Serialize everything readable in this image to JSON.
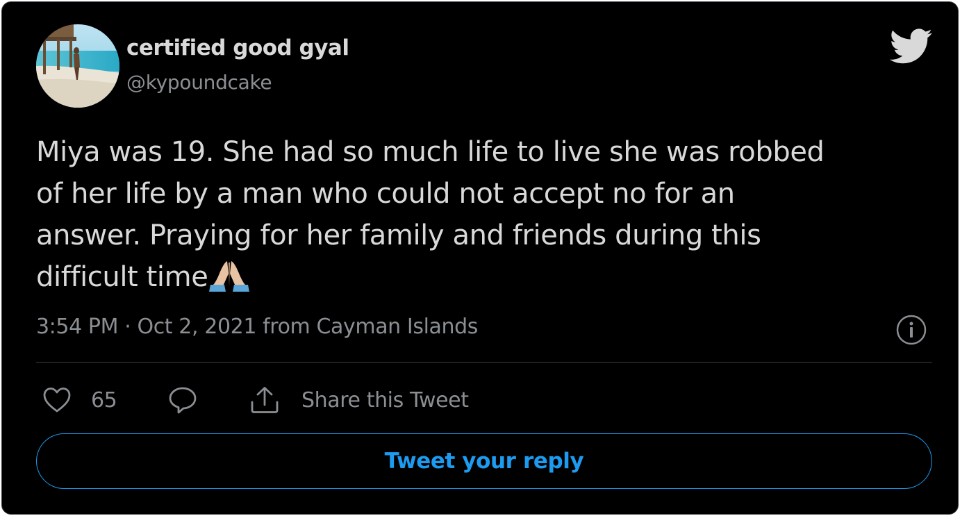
{
  "author": {
    "display_name": "certified good gyal",
    "handle": "@kypoundcake",
    "avatar": "beach-avatar"
  },
  "tweet": {
    "lines": [
      "Miya was 19. She had so much life to live she was robbed",
      "of her life by a man who could not accept no for an",
      "answer. Praying for her family and friends during this",
      "difficult time"
    ],
    "trailing_emoji": "folded-hands-emoji"
  },
  "meta": {
    "timestamp": "3:54 PM · Oct 2, 2021 from Cayman Islands"
  },
  "actions": {
    "like_count": "65",
    "share_label": "Share this Tweet"
  },
  "reply_button": {
    "label": "Tweet your reply"
  },
  "icons": {
    "brand": "twitter-bird-icon",
    "info": "info-icon",
    "like": "heart-icon",
    "reply": "speech-bubble-icon",
    "share": "share-upload-icon"
  },
  "colors": {
    "background": "#000000",
    "text": "#d9d9d9",
    "secondary_text": "#8b8f94",
    "accent": "#1d9bf0",
    "border": "#3a3f44"
  }
}
